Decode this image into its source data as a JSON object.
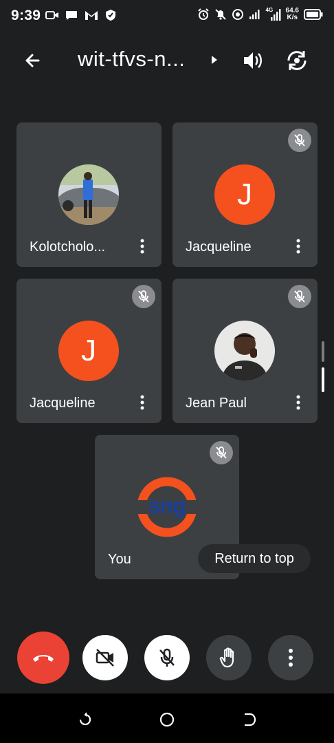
{
  "status_bar": {
    "time": "9:39",
    "network": "4G",
    "speed_value": "64.6",
    "speed_unit": "K/s"
  },
  "header": {
    "meeting_code": "wit-tfvs-n..."
  },
  "participants": [
    {
      "name": "Kolotcholo...",
      "avatar": "photo",
      "muted": false
    },
    {
      "name": "Jacqueline",
      "avatar": "letter",
      "initial": "J",
      "muted": true
    },
    {
      "name": "Jacqueline",
      "avatar": "letter",
      "initial": "J",
      "muted": true
    },
    {
      "name": "Jean Paul",
      "avatar": "photo",
      "muted": true
    },
    {
      "name": "You",
      "avatar": "logo",
      "logo_text": "sng",
      "muted": true
    }
  ],
  "return_to_top": "Return to top",
  "colors": {
    "end_call": "#ea4335",
    "avatar": "#f4511e",
    "tile": "#3c4043",
    "background": "#1e1f20"
  },
  "controls": [
    "end-call",
    "camera-off",
    "mic-off",
    "raise-hand",
    "more-options"
  ]
}
